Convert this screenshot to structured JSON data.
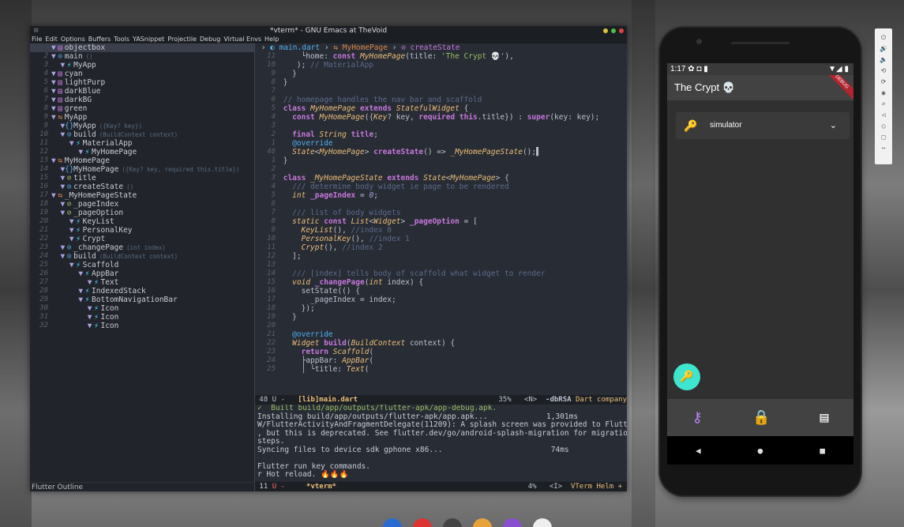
{
  "emacs": {
    "title": "*vterm* - GNU Emacs at TheVoid",
    "title_left": "≡",
    "menu": [
      "File",
      "Edit",
      "Options",
      "Buffers",
      "Tools",
      "YASnippet",
      "Projectile",
      "Debug",
      "Virtual Envs",
      "Help"
    ],
    "outline": [
      {
        "n": "",
        "i": "▼",
        "c": "",
        "icon": "▤",
        "k": "c",
        "t": "objectbox",
        "e": "",
        "hl": true
      },
      {
        "n": "2",
        "i": "▼",
        "c": "",
        "icon": "⊙",
        "k": "f",
        "t": "main",
        "e": "()"
      },
      {
        "n": "3",
        "i": "  ▼",
        "c": "",
        "icon": "⚡",
        "k": "w",
        "t": "MyApp",
        "e": ""
      },
      {
        "n": "4",
        "i": "▼",
        "c": "",
        "icon": "▤",
        "k": "c",
        "t": "cyan",
        "e": ""
      },
      {
        "n": "5",
        "i": "▼",
        "c": "",
        "icon": "▤",
        "k": "c",
        "t": "lightPurp",
        "e": ""
      },
      {
        "n": "6",
        "i": "▼",
        "c": "",
        "icon": "▤",
        "k": "c",
        "t": "darkBlue",
        "e": ""
      },
      {
        "n": "7",
        "i": "▼",
        "c": "",
        "icon": "▤",
        "k": "c",
        "t": "darkBG",
        "e": ""
      },
      {
        "n": "8",
        "i": "▼",
        "c": "",
        "icon": "▤",
        "k": "c",
        "t": "green",
        "e": ""
      },
      {
        "n": "9",
        "i": "▼",
        "c": "",
        "icon": "⇆",
        "k": "cl",
        "t": "MyApp",
        "e": ""
      },
      {
        "n": "9",
        "i": "  ▼",
        "c": "",
        "icon": "{}",
        "k": "f",
        "t": "MyApp",
        "e": "({Key? key})"
      },
      {
        "n": "10",
        "i": "  ▼",
        "c": "",
        "icon": "⊙",
        "k": "f",
        "t": "build",
        "e": "(BuildContext context)"
      },
      {
        "n": "11",
        "i": "    ▼",
        "c": "",
        "icon": "⚡",
        "k": "w",
        "t": "MaterialApp",
        "e": ""
      },
      {
        "n": "12",
        "i": "      ▼",
        "c": "",
        "icon": "⚡",
        "k": "w",
        "t": "MyHomePage",
        "e": ""
      },
      {
        "n": "13",
        "i": "▼",
        "c": "",
        "icon": "⇆",
        "k": "cl",
        "t": "MyHomePage",
        "e": ""
      },
      {
        "n": "14",
        "i": "  ▼",
        "c": "",
        "icon": "{}",
        "k": "f",
        "t": "MyHomePage",
        "e": "({Key? key, required this.title})"
      },
      {
        "n": "15",
        "i": "  ▼",
        "c": "",
        "icon": "⊘",
        "k": "v",
        "t": "title",
        "e": ""
      },
      {
        "n": "16",
        "i": "  ▼",
        "c": "",
        "icon": "⊙",
        "k": "f",
        "t": "createState",
        "e": "()"
      },
      {
        "n": "17",
        "i": "▼",
        "c": "",
        "icon": "⇆",
        "k": "cl",
        "t": "_MyHomePageState",
        "e": ""
      },
      {
        "n": "18",
        "i": "  ▼",
        "c": "",
        "icon": "⊘",
        "k": "v",
        "t": "_pageIndex",
        "e": ""
      },
      {
        "n": "19",
        "i": "  ▼",
        "c": "",
        "icon": "⊘",
        "k": "v",
        "t": "_pageOption",
        "e": ""
      },
      {
        "n": "20",
        "i": "    ▼",
        "c": "",
        "icon": "⚡",
        "k": "w",
        "t": "KeyList",
        "e": ""
      },
      {
        "n": "21",
        "i": "    ▼",
        "c": "",
        "icon": "⚡",
        "k": "w",
        "t": "PersonalKey",
        "e": ""
      },
      {
        "n": "22",
        "i": "    ▼",
        "c": "",
        "icon": "⚡",
        "k": "w",
        "t": "Crypt",
        "e": ""
      },
      {
        "n": "23",
        "i": "  ▼",
        "c": "",
        "icon": "⊙",
        "k": "f",
        "t": "_changePage",
        "e": "(int index)"
      },
      {
        "n": "24",
        "i": "  ▼",
        "c": "",
        "icon": "⊙",
        "k": "f",
        "t": "build",
        "e": "(BuildContext context)"
      },
      {
        "n": "25",
        "i": "    ▼",
        "c": "",
        "icon": "⚡",
        "k": "w",
        "t": "Scaffold",
        "e": ""
      },
      {
        "n": "26",
        "i": "      ▼",
        "c": "",
        "icon": "⚡",
        "k": "w",
        "t": "AppBar",
        "e": ""
      },
      {
        "n": "27",
        "i": "        ▼",
        "c": "",
        "icon": "⚡",
        "k": "w",
        "t": "Text",
        "e": ""
      },
      {
        "n": "28",
        "i": "      ▼",
        "c": "",
        "icon": "⚡",
        "k": "w",
        "t": "IndexedStack",
        "e": ""
      },
      {
        "n": "29",
        "i": "      ▼",
        "c": "",
        "icon": "⚡",
        "k": "w",
        "t": "BottomNavigationBar",
        "e": ""
      },
      {
        "n": "30",
        "i": "        ▼",
        "c": "",
        "icon": "⚡",
        "k": "w",
        "t": "Icon",
        "e": ""
      },
      {
        "n": "31",
        "i": "        ▼",
        "c": "",
        "icon": "⚡",
        "k": "w",
        "t": "Icon",
        "e": ""
      },
      {
        "n": "32",
        "i": "        ▼",
        "c": "",
        "icon": "⚡",
        "k": "w",
        "t": "Icon",
        "e": ""
      }
    ],
    "outline_mode": "Flutter Outline",
    "breadcrumb": {
      "file": "main.dart",
      "cls": "MyHomePage",
      "fn": "createState"
    },
    "code": [
      {
        "n": "11",
        "h": "    └home: <span class='k'>const</span> <span class='t'>MyHomePage</span>(title: <span class='s'>'The Crypt 💀'</span>),"
      },
      {
        "n": "10",
        "h": "   ); <span class='cm'>// MaterialApp</span>"
      },
      {
        "n": "9",
        "h": "  }"
      },
      {
        "n": "8",
        "h": "}"
      },
      {
        "n": "7",
        "h": ""
      },
      {
        "n": "6",
        "h": "<span class='cm'>// homepage handles the nav bar and scaffold</span>"
      },
      {
        "n": "5",
        "h": "<span class='k'>class</span> <span class='t'>MyHomePage</span> <span class='k'>extends</span> <span class='t'>StatefulWidget</span> {"
      },
      {
        "n": "4",
        "h": "  <span class='k'>const</span> <span class='t'>MyHomePage</span>({<span class='t'>Key</span>? key, <span class='k'>required</span> <span class='k'>this</span>.title}) : <span class='k'>super</span>(key: key);"
      },
      {
        "n": "3",
        "h": ""
      },
      {
        "n": "2",
        "h": "  <span class='k'>final</span> <span class='t'>String</span> <span class='k'>title</span>;"
      },
      {
        "n": "1",
        "h": "  <span class='p'>@override</span>"
      },
      {
        "n": "48",
        "h": "  <span class='t'>State</span>&lt;<span class='t'>MyHomePage</span>&gt; <span class='k'>createState</span>() =&gt; <span class='t'>_MyHomePageState</span>();▌"
      },
      {
        "n": "1",
        "h": "}"
      },
      {
        "n": "2",
        "h": ""
      },
      {
        "n": "3",
        "h": "<span class='k'>class</span> <span class='t'>_MyHomePageState</span> <span class='k'>extends</span> <span class='t'>State</span>&lt;<span class='t'>MyHomePage</span>&gt; {"
      },
      {
        "n": "4",
        "h": "  <span class='cm'>/// determine body widget ie page to be rendered</span>"
      },
      {
        "n": "5",
        "h": "  <span class='t'>int</span> <span class='k'>_pageIndex</span> = <span class='ty'>0</span>;"
      },
      {
        "n": "6",
        "h": ""
      },
      {
        "n": "7",
        "h": "  <span class='cm'>/// list of body widgets</span>"
      },
      {
        "n": "8",
        "h": "  <span class='t'>static</span> <span class='k'>const</span> <span class='t'>List</span>&lt;<span class='t'>Widget</span>&gt; <span class='k'>_pageOption</span> = ["
      },
      {
        "n": "9",
        "h": "    <span class='t'>KeyList</span>(), <span class='cm'>//index 0</span>"
      },
      {
        "n": "10",
        "h": "    <span class='t'>PersonalKey</span>(), <span class='cm'>//index 1</span>"
      },
      {
        "n": "11",
        "h": "    <span class='t'>Crypt</span>(), <span class='cm'>//index 2</span>"
      },
      {
        "n": "12",
        "h": "  ];"
      },
      {
        "n": "13",
        "h": ""
      },
      {
        "n": "14",
        "h": "  <span class='cm'>/// [index] tells body of scaffold what widget to render</span>"
      },
      {
        "n": "15",
        "h": "  <span class='t'>void</span> <span class='k'>_changePage</span>(<span class='t'>int</span> index) {"
      },
      {
        "n": "16",
        "h": "    setState(() {"
      },
      {
        "n": "17",
        "h": "      _pageIndex = index;"
      },
      {
        "n": "18",
        "h": "    });"
      },
      {
        "n": "19",
        "h": "  }"
      },
      {
        "n": "20",
        "h": ""
      },
      {
        "n": "21",
        "h": "  <span class='p'>@override</span>"
      },
      {
        "n": "22",
        "h": "  <span class='t'>Widget</span> <span class='k'>build</span>(<span class='t'>BuildContext</span> context) {"
      },
      {
        "n": "23",
        "h": "    <span class='k'>return</span> <span class='t'>Scaffold</span>("
      },
      {
        "n": "24",
        "h": "    ├appBar: <span class='t'>AppBar</span>("
      },
      {
        "n": "25",
        "h": "    │ └title: <span class='t'>Text</span>("
      }
    ],
    "modeline1": {
      "left": " 48 U -   ",
      "buf": "[lib]main.dart",
      "pct": "35%",
      "pos": "<N>",
      "mode": "-dbRSA",
      "major": "Dart company"
    },
    "terminal": [
      "✓  Built build/app/outputs/flutter-apk/app-debug.apk.",
      "Installing build/app/outputs/flutter-apk/app.apk...             1,301ms",
      "W/FlutterActivityAndFragmentDelegate(11209): A splash screen was provided to Flutter",
      ", but this is deprecated. See flutter.dev/go/android-splash-migration for migration",
      "steps.",
      "Syncing files to device sdk gphone x86...                        74ms",
      "",
      "Flutter run key commands.",
      "r Hot reload. 🔥🔥🔥"
    ],
    "modeline2": {
      "num": " 11 ",
      "u": "U -",
      "buf": "*vterm*",
      "pct": "4%",
      "pos": "<I>",
      "mode": "VTerm Helm +"
    }
  },
  "phone": {
    "time": "1:17",
    "status_icons_left": "✿ ◘ ▮",
    "status_icons_right": "▼◢ ▮",
    "debug_banner": "DEBUG",
    "app_title": "The Crypt 💀",
    "dropdown_value": "simulator",
    "nav_icons": [
      "key-icon",
      "lock-icon",
      "message-icon"
    ],
    "accent": "#bb86fc",
    "fab_color": "#3fe6cf"
  }
}
